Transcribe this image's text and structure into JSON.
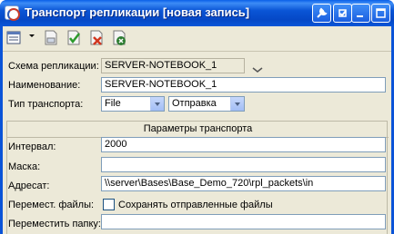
{
  "window": {
    "title": "Транспорт репликации [новая запись]"
  },
  "toolbar": {
    "items": [
      "menu-icon",
      "save-icon",
      "save-close-icon",
      "delete-icon",
      "close-window-icon"
    ]
  },
  "form": {
    "scheme_label": "Схема репликации:",
    "scheme_value": "SERVER-NOTEBOOK_1",
    "name_label": "Наименование:",
    "name_value": "SERVER-NOTEBOOK_1",
    "transport_type_label": "Тип транспорта:",
    "transport_type_value": "File",
    "direction_value": "Отправка"
  },
  "params": {
    "group_title": "Параметры транспорта",
    "interval_label": "Интервал:",
    "interval_value": "2000",
    "mask_label": "Маска:",
    "mask_value": "",
    "address_label": "Адресат:",
    "address_value": "\\\\server\\Bases\\Base_Demo_720\\rpl_packets\\in",
    "move_files_label": "Перемест. файлы:",
    "save_sent_label": "Сохранять отправленные файлы",
    "save_sent_checked": false,
    "move_folder_label": "Переместить папку:",
    "move_folder_value": ""
  },
  "colors": {
    "titlebar": "#0a55d6",
    "client_bg": "#ece9d8",
    "field_border": "#7f9db9"
  }
}
